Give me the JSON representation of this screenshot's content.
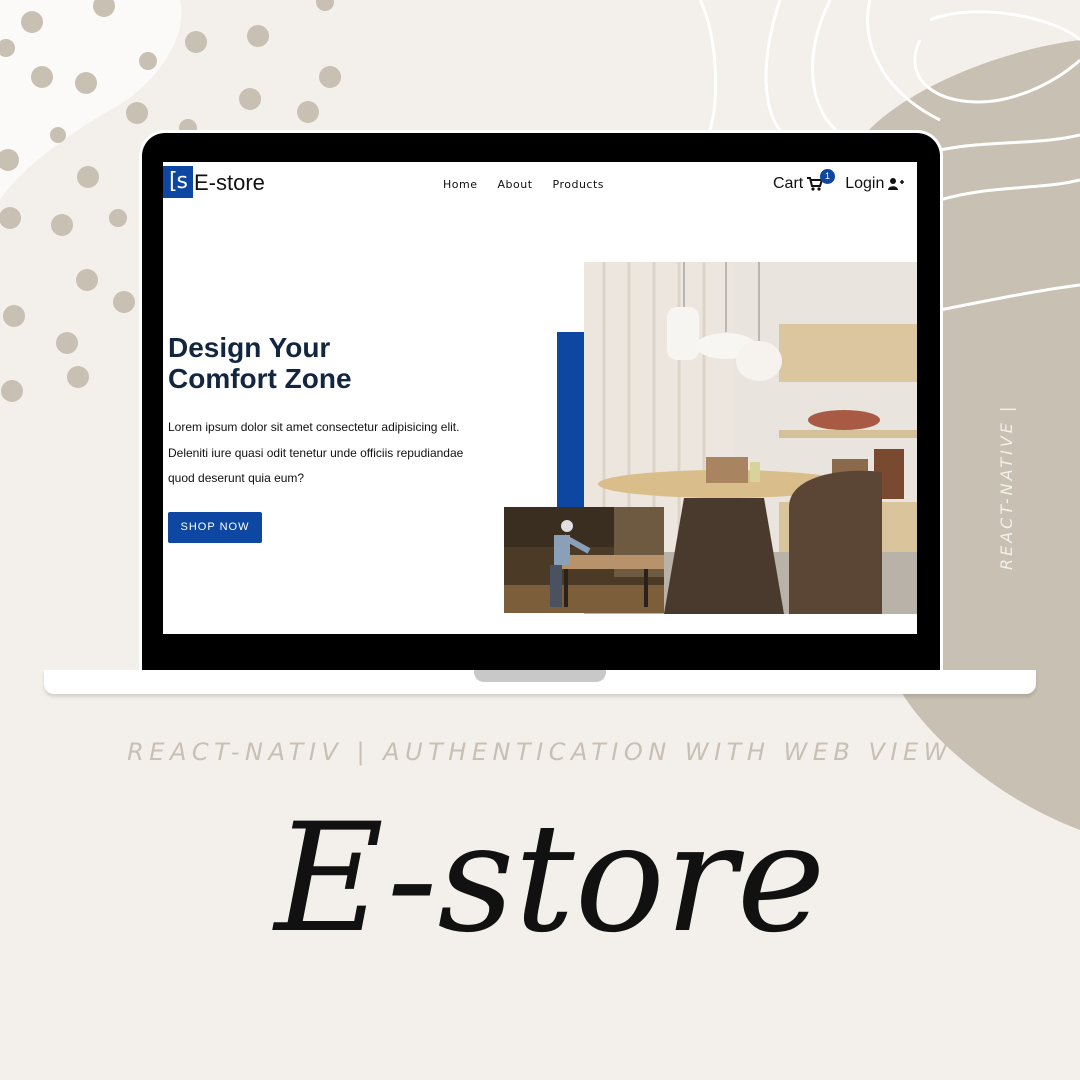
{
  "nav": {
    "logo_mark": "[s",
    "logo_text": "E-store",
    "links": [
      "Home",
      "About",
      "Products"
    ],
    "cart_label": "Cart",
    "cart_count": "1",
    "login_label": "Login"
  },
  "hero": {
    "title_line1": "Design Your",
    "title_line2": "Comfort Zone",
    "text_line1": "Lorem ipsum dolor sit amet consectetur adipisicing elit.",
    "text_line2": "Deleniti iure quasi odit tenetur unde officiis repudiandae",
    "text_line3": "quod deserunt quia eum?",
    "cta_label": "SHOP NOW"
  },
  "poster": {
    "subtitle": "REACT-NATIV | AUTHENTICATION WITH WEB VIEW",
    "vertical_text": "REACT-NATIVE |",
    "script_title": "E-store"
  },
  "colors": {
    "accent": "#0d47a1",
    "title": "#12263f",
    "beige": "#c8c0b2",
    "background": "#f3efea"
  },
  "icons": [
    "cart-icon",
    "user-plus-icon"
  ]
}
